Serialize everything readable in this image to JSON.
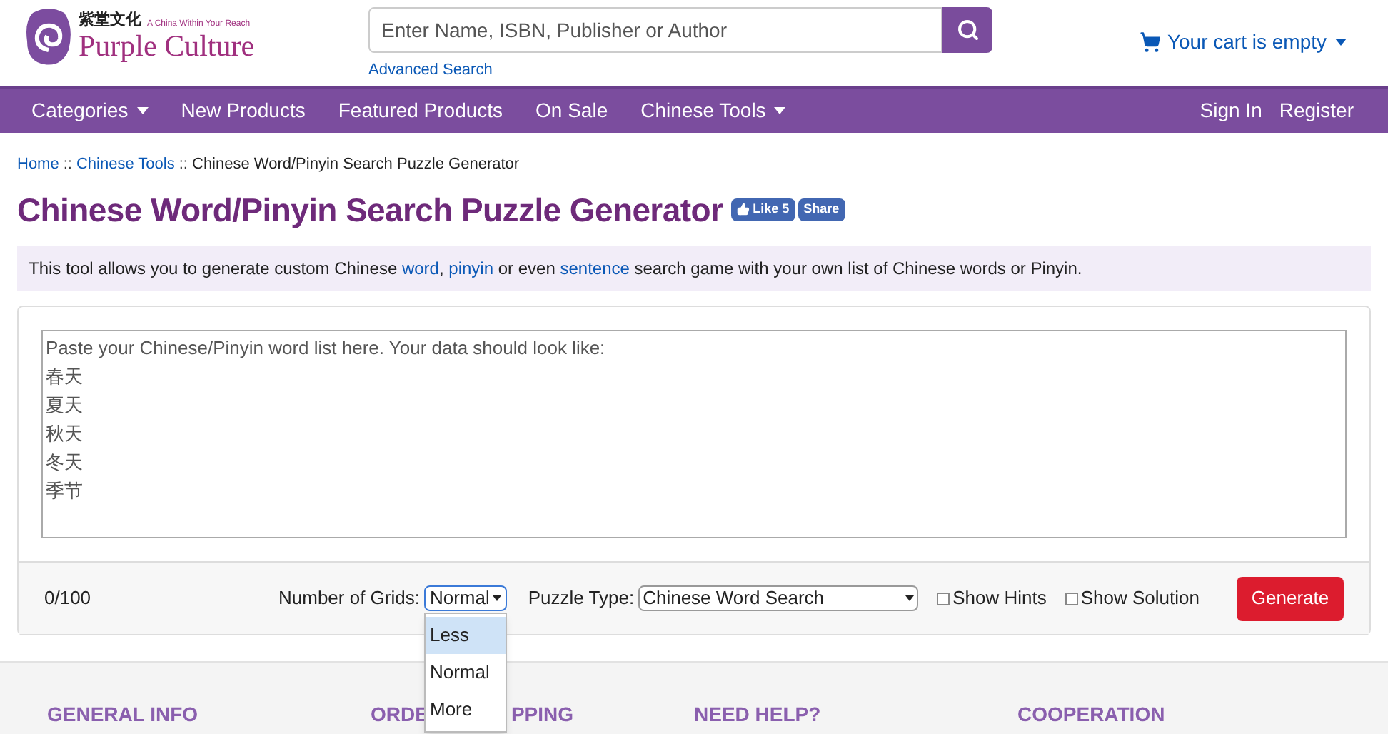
{
  "header": {
    "logo": {
      "chinese": "紫堂文化",
      "tagline": "A China Within Your Reach",
      "name": "Purple Culture"
    },
    "search": {
      "placeholder": "Enter Name, ISBN, Publisher or Author"
    },
    "advanced_search": "Advanced Search",
    "cart": "Your cart is empty"
  },
  "nav": {
    "left": [
      {
        "label": "Categories",
        "dropdown": true
      },
      {
        "label": "New Products",
        "dropdown": false
      },
      {
        "label": "Featured Products",
        "dropdown": false
      },
      {
        "label": "On Sale",
        "dropdown": false
      },
      {
        "label": "Chinese Tools",
        "dropdown": true
      }
    ],
    "right": [
      "Sign In",
      "Register"
    ]
  },
  "breadcrumb": [
    {
      "label": "Home",
      "link": true,
      "separator": "::"
    },
    {
      "label": "Chinese Tools",
      "link": true,
      "separator": "::"
    },
    {
      "label": "Chinese Word/Pinyin Search Puzzle Generator",
      "link": false
    }
  ],
  "title": "Chinese Word/Pinyin Search Puzzle Generator",
  "social": {
    "like": "Like 5",
    "share": "Share"
  },
  "intro": [
    {
      "text": "This tool allows you to generate custom Chinese ",
      "link": false
    },
    {
      "text": "word",
      "link": true
    },
    {
      "text": ", ",
      "link": false
    },
    {
      "text": "pinyin",
      "link": true
    },
    {
      "text": " or even ",
      "link": false
    },
    {
      "text": "sentence",
      "link": true
    },
    {
      "text": " search game with your own list of Chinese words or Pinyin.",
      "link": false
    }
  ],
  "word_list": {
    "placeholder_lines": [
      "Paste your Chinese/Pinyin word list here. Your data should look like:",
      "春天",
      "夏天",
      "秋天",
      "冬天",
      "季节"
    ]
  },
  "counter": "0/100",
  "grids": {
    "label": "Number of Grids:",
    "value": "Normal",
    "options": [
      {
        "label": "Less",
        "highlighted": true
      },
      {
        "label": "Normal",
        "highlighted": false
      },
      {
        "label": "More",
        "highlighted": false
      }
    ]
  },
  "puzzle_type": {
    "label": "Puzzle Type:",
    "value": "Chinese Word Search"
  },
  "checkboxes": [
    {
      "label": "Show Hints",
      "checked": false
    },
    {
      "label": "Show Solution",
      "checked": false
    }
  ],
  "generate": "Generate",
  "footer": [
    {
      "visible_parts": [
        "GENERAL INFO"
      ]
    },
    {
      "visible_parts": [
        "ORDE",
        "PPING"
      ]
    },
    {
      "visible_parts": [
        "NEED HELP?"
      ]
    },
    {
      "visible_parts": [
        "COOPERATION"
      ]
    }
  ]
}
